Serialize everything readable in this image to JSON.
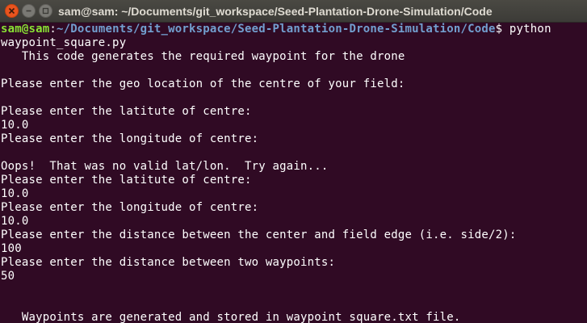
{
  "window": {
    "title": "sam@sam: ~/Documents/git_workspace/Seed-Plantation-Drone-Simulation/Code"
  },
  "prompt": {
    "user_host": "sam@sam",
    "separator": ":",
    "path": "~/Documents/git_workspace/Seed-Plantation-Drone-Simulation/Code",
    "symbol": "$ ",
    "command": "python"
  },
  "output_lines": [
    "waypoint_square.py",
    "   This code generates the required waypoint for the drone",
    "",
    "Please enter the geo location of the centre of your field:",
    "",
    "Please enter the latitute of centre:",
    "10.0",
    "Please enter the longitude of centre:",
    "",
    "Oops!  That was no valid lat/lon.  Try again...",
    "Please enter the latitute of centre:",
    "10.0",
    "Please enter the longitude of centre:",
    "10.0",
    "Please enter the distance between the center and field edge (i.e. side/2):",
    "100",
    "Please enter the distance between two waypoints:",
    "50",
    "",
    "",
    "   Waypoints are generated and stored in waypoint_square.txt file.",
    ""
  ]
}
